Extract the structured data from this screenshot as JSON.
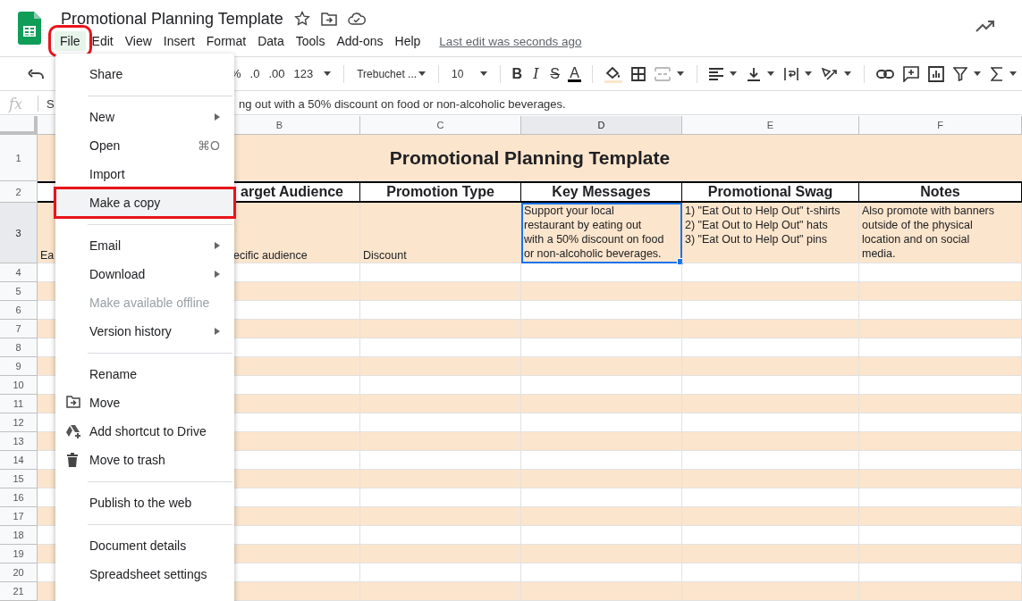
{
  "app": {
    "title": "Promotional Planning Template",
    "last_edit": "Last edit was seconds ago"
  },
  "menubar": [
    {
      "label": "File",
      "selected": true,
      "annotated": true
    },
    {
      "label": "Edit",
      "selected": false,
      "annotated": false
    },
    {
      "label": "View",
      "selected": false,
      "annotated": false
    },
    {
      "label": "Insert",
      "selected": false,
      "annotated": false
    },
    {
      "label": "Format",
      "selected": false,
      "annotated": false
    },
    {
      "label": "Data",
      "selected": false,
      "annotated": false
    },
    {
      "label": "Tools",
      "selected": false,
      "annotated": false
    },
    {
      "label": "Add-ons",
      "selected": false,
      "annotated": false
    },
    {
      "label": "Help",
      "selected": false,
      "annotated": false
    }
  ],
  "toolbar": {
    "number_formats": [
      "%",
      ".0",
      ".00",
      "123"
    ],
    "font": "Trebuchet ...",
    "font_size": "10",
    "text_styles": [
      "B",
      "I",
      "S",
      "A"
    ]
  },
  "formula_bar": {
    "label": "fx",
    "value_start": "S",
    "value_end": "ng out with a 50% discount on food or non-alcoholic beverages."
  },
  "sheet": {
    "columns": [
      {
        "selected": false
      },
      {
        "letter": "B",
        "selected": false
      },
      {
        "letter": "C",
        "selected": false
      },
      {
        "letter": "D",
        "selected": true
      },
      {
        "letter": "E",
        "selected": false
      },
      {
        "letter": "F",
        "selected": false
      }
    ],
    "rows": [
      {
        "number": "1",
        "selected": false
      },
      {
        "number": "2",
        "selected": false
      },
      {
        "number": "3",
        "selected": true
      },
      {
        "number": "4",
        "selected": false
      },
      {
        "number": "5",
        "selected": false
      },
      {
        "number": "6",
        "selected": false
      },
      {
        "number": "7",
        "selected": false
      },
      {
        "number": "8",
        "selected": false
      },
      {
        "number": "9",
        "selected": false
      },
      {
        "number": "10",
        "selected": false
      },
      {
        "number": "11",
        "selected": false
      },
      {
        "number": "12",
        "selected": false
      },
      {
        "number": "13",
        "selected": false
      },
      {
        "number": "14",
        "selected": false
      },
      {
        "number": "15",
        "selected": false
      },
      {
        "number": "16",
        "selected": false
      },
      {
        "number": "17",
        "selected": false
      },
      {
        "number": "18",
        "selected": false
      },
      {
        "number": "19",
        "selected": false
      },
      {
        "number": "20",
        "selected": false
      },
      {
        "number": "21",
        "selected": false
      }
    ],
    "title": "Promotional Planning Template",
    "header_cells": [
      "arget Audience",
      "Promotion Type",
      "Key Messages",
      "Promotional Swag",
      "Notes"
    ],
    "row_3_cells": [
      {
        "text": "Ea",
        "selected": false
      },
      {
        "text": "ecific audience",
        "selected": false
      },
      {
        "text": "Discount",
        "selected": false
      },
      {
        "text": "Support your local\nrestaurant by eating out\nwith a 50% discount on food\nor non-alcoholic beverages.",
        "selected": true
      },
      {
        "text": "1) \"Eat Out to Help Out\" t-shirts\n2) \"Eat Out to Help Out\" hats\n3) \"Eat Out to Help Out\" pins",
        "selected": false
      },
      {
        "text": "Also promote with banners\noutside of the physical\nlocation and on social\nmedia.",
        "selected": false
      }
    ]
  },
  "file_menu": [
    {
      "kind": "item",
      "label": "Share",
      "submenu": false,
      "disabled": false,
      "selected": false,
      "annotated": false
    },
    {
      "kind": "divider"
    },
    {
      "kind": "item",
      "label": "New",
      "submenu": true,
      "disabled": false,
      "selected": false,
      "annotated": false
    },
    {
      "kind": "item",
      "label": "Open",
      "shortcut": "⌘O",
      "submenu": false,
      "disabled": false,
      "selected": false,
      "annotated": false
    },
    {
      "kind": "item",
      "label": "Import",
      "submenu": false,
      "disabled": false,
      "selected": false,
      "annotated": false
    },
    {
      "kind": "item",
      "label": "Make a copy",
      "submenu": false,
      "disabled": false,
      "selected": true,
      "annotated": true
    },
    {
      "kind": "divider"
    },
    {
      "kind": "item",
      "label": "Email",
      "submenu": true,
      "disabled": false,
      "selected": false,
      "annotated": false
    },
    {
      "kind": "item",
      "label": "Download",
      "submenu": true,
      "disabled": false,
      "selected": false,
      "annotated": false
    },
    {
      "kind": "item",
      "label": "Make available offline",
      "submenu": false,
      "disabled": true,
      "selected": false,
      "annotated": false
    },
    {
      "kind": "item",
      "label": "Version history",
      "submenu": true,
      "disabled": false,
      "selected": false,
      "annotated": false
    },
    {
      "kind": "divider"
    },
    {
      "kind": "item",
      "label": "Rename",
      "submenu": false,
      "disabled": false,
      "selected": false,
      "annotated": false
    },
    {
      "kind": "icon-item",
      "label": "Move",
      "submenu": false,
      "disabled": false,
      "selected": false,
      "annotated": false
    },
    {
      "kind": "icon-item",
      "label": "Add shortcut to Drive",
      "submenu": false,
      "disabled": false,
      "selected": false,
      "annotated": false
    },
    {
      "kind": "icon-item",
      "label": "Move to trash",
      "submenu": false,
      "disabled": false,
      "selected": false,
      "annotated": false
    },
    {
      "kind": "divider"
    },
    {
      "kind": "item",
      "label": "Publish to the web",
      "submenu": false,
      "disabled": false,
      "selected": false,
      "annotated": false
    },
    {
      "kind": "divider"
    },
    {
      "kind": "item",
      "label": "Document details",
      "submenu": false,
      "disabled": false,
      "selected": false,
      "annotated": false
    },
    {
      "kind": "item",
      "label": "Spreadsheet settings",
      "submenu": false,
      "disabled": false,
      "selected": false,
      "annotated": false
    }
  ]
}
